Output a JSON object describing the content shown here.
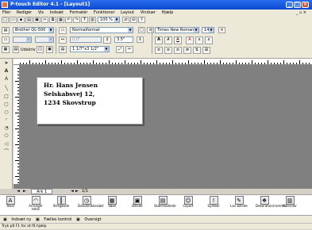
{
  "title": "P-touch Editor 4.1 - [Layout1]",
  "menu": [
    "Filer",
    "Redigér",
    "Vis",
    "Indsæt",
    "Formatér",
    "Funktioner",
    "Layout",
    "Vinduer",
    "Hjælp"
  ],
  "toolbar": {
    "zoom": "100 %",
    "text_tool": "T"
  },
  "printer": {
    "name": "Brother QL-500",
    "length_mode": "Normalformat",
    "print_label": "Udskriv"
  },
  "paper": {
    "size": "1 1/7\"x3 1/2\"",
    "length_value": "0.0\"",
    "width_value": "3.5\""
  },
  "font": {
    "family": "Times New Roman",
    "size": "14"
  },
  "label": {
    "line1": "Hr. Hans Jensen",
    "line2": "Selskabsvej 12,",
    "line3": "1234 Skovstrup"
  },
  "sheet": {
    "tab": "Ark 1",
    "page": "1/1"
  },
  "objects": [
    "Tekst",
    "Arrangér tekst",
    "Stregkode",
    "Dato/klokkeslæt",
    "Tabel",
    "Billede",
    "Skærmbillede",
    "Clipart",
    "Symbol",
    "Lav billede",
    "Dekoration/ramme",
    "Kalender"
  ],
  "bottom_tabs": [
    "Indsæt ny",
    "Fælles kontrol",
    "Oversigt"
  ],
  "status": "Tryk på F1 for at få hjælp"
}
